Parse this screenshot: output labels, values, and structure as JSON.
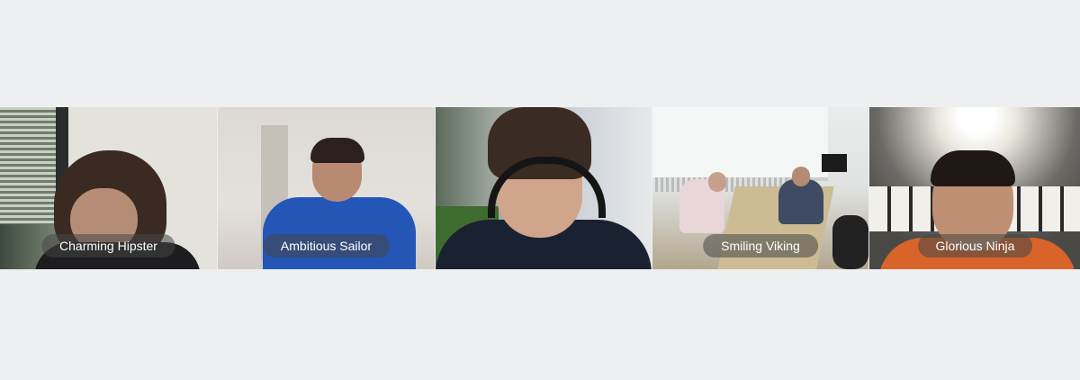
{
  "participants": [
    {
      "name": "Charming Hipster"
    },
    {
      "name": "Ambitious Sailor"
    },
    {
      "name": ""
    },
    {
      "name": "Smiling Viking"
    },
    {
      "name": "Glorious Ninja"
    }
  ],
  "colors": {
    "page_background": "#eeeff1",
    "name_tag_background": "rgba(70,70,70,0.55)",
    "name_tag_text": "#ffffff"
  }
}
